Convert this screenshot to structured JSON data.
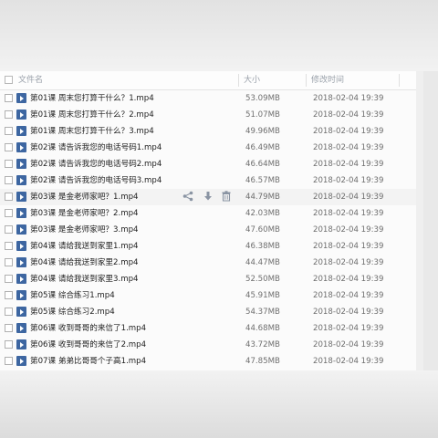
{
  "header": {
    "col_name": "文件名",
    "col_size": "大小",
    "col_time": "修改时间"
  },
  "files": [
    {
      "name": "第01课 周末您打算干什么？1.mp4",
      "size": "53.09MB",
      "time": "2018-02-04 19:39"
    },
    {
      "name": "第01课 周末您打算干什么？2.mp4",
      "size": "51.07MB",
      "time": "2018-02-04 19:39"
    },
    {
      "name": "第01课 周末您打算干什么？3.mp4",
      "size": "49.96MB",
      "time": "2018-02-04 19:39"
    },
    {
      "name": "第02课 请告诉我您的电话号码1.mp4",
      "size": "46.49MB",
      "time": "2018-02-04 19:39"
    },
    {
      "name": "第02课 请告诉我您的电话号码2.mp4",
      "size": "46.64MB",
      "time": "2018-02-04 19:39"
    },
    {
      "name": "第02课 请告诉我您的电话号码3.mp4",
      "size": "46.57MB",
      "time": "2018-02-04 19:39"
    },
    {
      "name": "第03课 是金老师家吧？1.mp4",
      "size": "44.79MB",
      "time": "2018-02-04 19:39"
    },
    {
      "name": "第03课 是金老师家吧？2.mp4",
      "size": "42.03MB",
      "time": "2018-02-04 19:39"
    },
    {
      "name": "第03课 是金老师家吧？3.mp4",
      "size": "47.60MB",
      "time": "2018-02-04 19:39"
    },
    {
      "name": "第04课 请给我送到家里1.mp4",
      "size": "46.38MB",
      "time": "2018-02-04 19:39"
    },
    {
      "name": "第04课 请给我送到家里2.mp4",
      "size": "44.47MB",
      "time": "2018-02-04 19:39"
    },
    {
      "name": "第04课 请给我送到家里3.mp4",
      "size": "52.50MB",
      "time": "2018-02-04 19:39"
    },
    {
      "name": "第05课 综合练习1.mp4",
      "size": "45.91MB",
      "time": "2018-02-04 19:39"
    },
    {
      "name": "第05课 综合练习2.mp4",
      "size": "54.37MB",
      "time": "2018-02-04 19:39"
    },
    {
      "name": "第06课 收到哥哥的来信了1.mp4",
      "size": "44.68MB",
      "time": "2018-02-04 19:39"
    },
    {
      "name": "第06课 收到哥哥的来信了2.mp4",
      "size": "43.72MB",
      "time": "2018-02-04 19:39"
    },
    {
      "name": "第07课 弟弟比哥哥个子高1.mp4",
      "size": "47.85MB",
      "time": "2018-02-04 19:39"
    }
  ],
  "hovered_row": 6,
  "row_actions": [
    "share-icon",
    "download-icon",
    "delete-icon"
  ],
  "colors": {
    "file_icon": "#3d66a1",
    "action_icon": "#8a94a3"
  }
}
